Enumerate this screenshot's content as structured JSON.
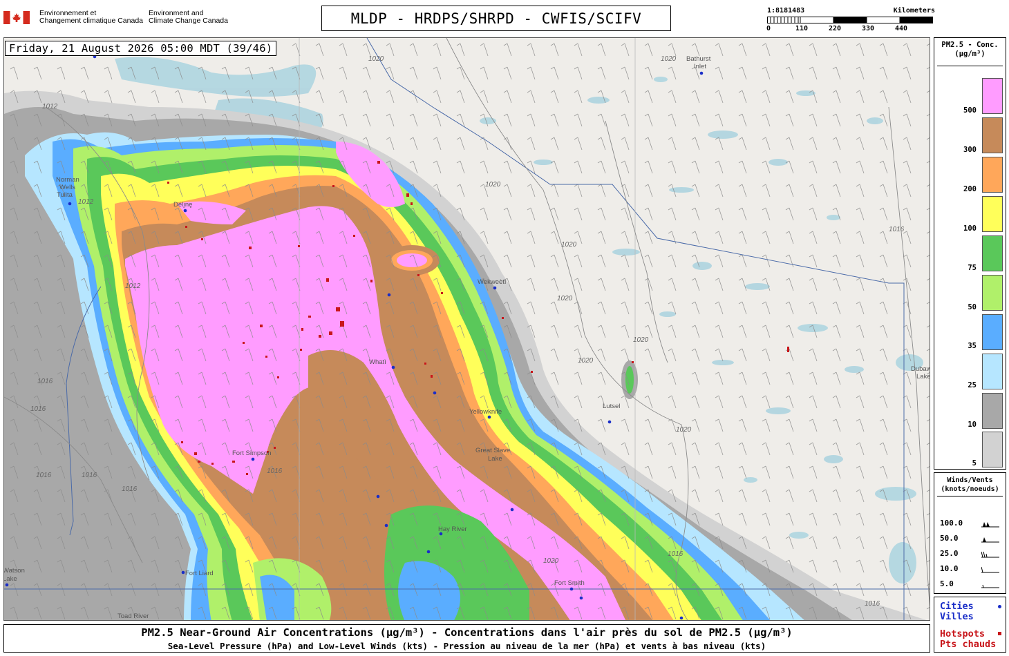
{
  "header": {
    "gov_fr": "Environnement et\nChangement climatique Canada",
    "gov_en": "Environment and\nClimate Change Canada",
    "title": "MLDP - HRDPS/SHRPD - CWFIS/SCIFV",
    "scale": {
      "ratio": "1:8181483",
      "units": "Kilometers",
      "ticks": [
        "0",
        "110",
        "220",
        "330",
        "440"
      ]
    }
  },
  "map": {
    "datetime": "Friday, 21 August 2026 05:00 MDT (39/46)",
    "places": [
      {
        "name": "Bathurst"
      },
      {
        "name": "Inlet"
      },
      {
        "name": "Norman"
      },
      {
        "name": "Wells"
      },
      {
        "name": "Tulita"
      },
      {
        "name": "Délı̨nę"
      },
      {
        "name": "Wekweètì"
      },
      {
        "name": "Whatì"
      },
      {
        "name": "Yellowknife"
      },
      {
        "name": "Great Slave"
      },
      {
        "name": "Lake"
      },
      {
        "name": "Lutsel"
      },
      {
        "name": "Fort Simpson"
      },
      {
        "name": "Hay River"
      },
      {
        "name": "Fort Liard"
      },
      {
        "name": "Fort Smith"
      },
      {
        "name": "Watson"
      },
      {
        "name": "Lake"
      },
      {
        "name": "Toad River"
      },
      {
        "name": "Dubawnt"
      },
      {
        "name": "Lake"
      }
    ],
    "isobar_labels": [
      "1012",
      "1012",
      "1012",
      "1016",
      "1016",
      "1016",
      "1016",
      "1016",
      "1016",
      "1020",
      "1020",
      "1020",
      "1020",
      "1020",
      "1020",
      "1020",
      "1020",
      "1020",
      "1016",
      "1016",
      "1016"
    ]
  },
  "legend_pm": {
    "title": "PM2.5 - Conc.\n(µg/m³)",
    "levels": [
      {
        "label": "500",
        "color": "#ff9cff"
      },
      {
        "label": "300",
        "color": "#c68a5a"
      },
      {
        "label": "200",
        "color": "#ffa75a"
      },
      {
        "label": "100",
        "color": "#ffff5a"
      },
      {
        "label": "75",
        "color": "#5ac85a"
      },
      {
        "label": "50",
        "color": "#b0f06a"
      },
      {
        "label": "35",
        "color": "#5aadff"
      },
      {
        "label": "25",
        "color": "#b6e6ff"
      },
      {
        "label": "10",
        "color": "#a8a8a8"
      },
      {
        "label": "5",
        "color": "#d2d2d2"
      }
    ]
  },
  "legend_wind": {
    "title": "Winds/Vents\n(knots/noeuds)",
    "rows": [
      "100.0",
      "50.0",
      "25.0",
      "10.0",
      "5.0"
    ]
  },
  "legend_points": {
    "cities_en": "Cities",
    "cities_fr": "Villes",
    "hot_en": "Hotspots",
    "hot_fr": "Pts chauds",
    "city_color": "#1a2ec8",
    "hotspot_color": "#c8161b"
  },
  "caption": {
    "line1": "PM2.5 Near-Ground Air Concentrations (µg/m³) - Concentrations dans l'air près du sol de PM2.5 (µg/m³)",
    "line2": "Sea-Level Pressure (hPa) and Low-Level Winds (kts) - Pression au niveau de la mer (hPa) et vents à bas niveau (kts)"
  }
}
